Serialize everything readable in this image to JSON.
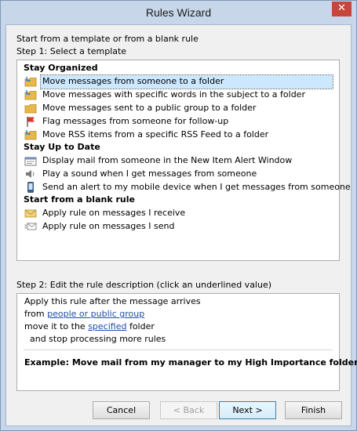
{
  "window": {
    "title": "Rules Wizard",
    "close_glyph": "✕"
  },
  "intro": {
    "line1": "Start from a template or from a blank rule",
    "line2": "Step 1: Select a template"
  },
  "templates": {
    "stay_organized": {
      "label": "Stay Organized",
      "items": [
        {
          "label": "Move messages from someone to a folder",
          "icon": "folder-arrow-icon",
          "selected": true
        },
        {
          "label": "Move messages with specific words in the subject to a folder",
          "icon": "folder-arrow-icon"
        },
        {
          "label": "Move messages sent to a public group to a folder",
          "icon": "folder-icon"
        },
        {
          "label": "Flag messages from someone for follow-up",
          "icon": "flag-icon"
        },
        {
          "label": "Move RSS items from a specific RSS Feed to a folder",
          "icon": "folder-arrow-icon"
        }
      ]
    },
    "stay_up_to_date": {
      "label": "Stay Up to Date",
      "items": [
        {
          "label": "Display mail from someone in the New Item Alert Window",
          "icon": "alert-window-icon"
        },
        {
          "label": "Play a sound when I get messages from someone",
          "icon": "speaker-icon"
        },
        {
          "label": "Send an alert to my mobile device when I get messages from someone",
          "icon": "mobile-device-icon"
        }
      ]
    },
    "blank_rule": {
      "label": "Start from a blank rule",
      "items": [
        {
          "label": "Apply rule on messages I receive",
          "icon": "envelope-icon"
        },
        {
          "label": "Apply rule on messages I send",
          "icon": "send-envelope-icon"
        }
      ]
    }
  },
  "step2": {
    "label": "Step 2: Edit the rule description (click an underlined value)",
    "line1": "Apply this rule after the message arrives",
    "line2_prefix": "from ",
    "line2_link": "people or public group",
    "line3_prefix": "move it to the ",
    "line3_link": "specified",
    "line3_suffix": " folder",
    "line4": "  and stop processing more rules",
    "example": "Example: Move mail from my manager to my High Importance folder"
  },
  "buttons": {
    "cancel": "Cancel",
    "back": "< Back",
    "next": "Next >",
    "finish": "Finish"
  }
}
